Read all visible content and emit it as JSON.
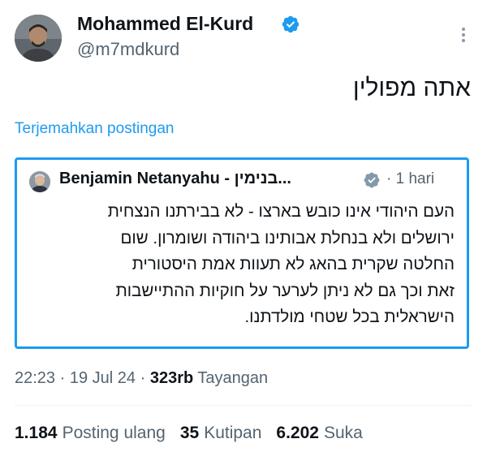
{
  "author": {
    "name": "Mohammed El-Kurd",
    "handle": "@m7mdkurd",
    "verified_icon": "verified-badge-icon"
  },
  "tweet": {
    "text": "אתה מפולין",
    "translate_label": "Terjemahkan postingan"
  },
  "quote": {
    "name": "Benjamin Netanyahu - בנימין...",
    "separator": "·",
    "time": "1 hari",
    "lines": [
      "העם היהודי אינו כובש בארצו - לא בבירתנו הנצחית",
      "ירושלים ולא בנחלת אבותינו ביהודה ושומרון. שום",
      "החלטה שקרית בהאג לא תעוות אמת היסטורית",
      "זאת וכך גם לא ניתן לערער על חוקיות ההתיישבות",
      "הישראלית בכל שטחי מולדתנו."
    ]
  },
  "meta": {
    "time": "22:23",
    "date": "19 Jul 24",
    "views_count": "323rb",
    "views_label": "Tayangan",
    "separator": "·"
  },
  "stats": {
    "reposts_count": "1.184",
    "reposts_label": "Posting ulang",
    "quotes_count": "35",
    "quotes_label": "Kutipan",
    "likes_count": "6.202",
    "likes_label": "Suka"
  },
  "colors": {
    "accent": "#1d9bf0",
    "secondary_text": "#536471",
    "primary_text": "#0f1419",
    "verified_gray": "#829aab"
  }
}
